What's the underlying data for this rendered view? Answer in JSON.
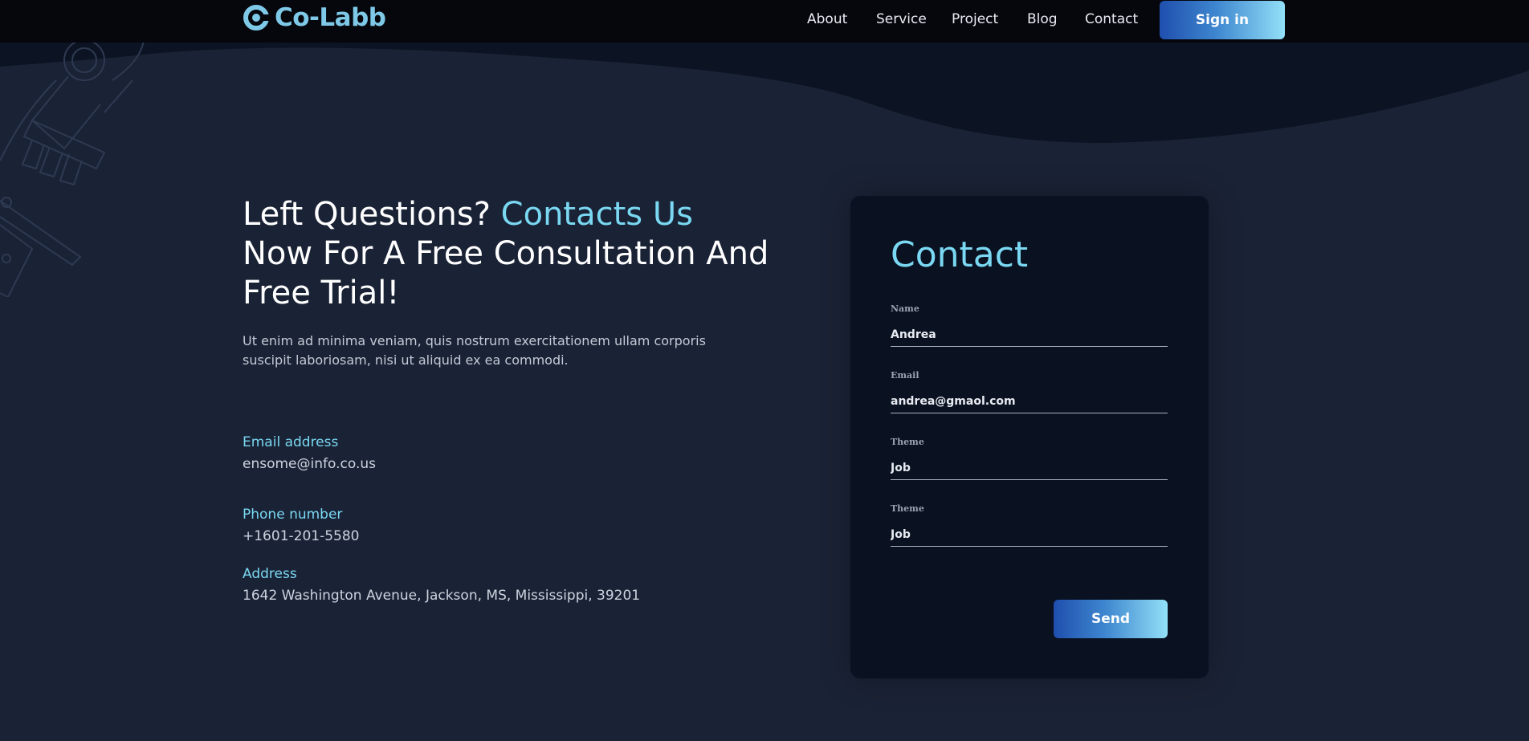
{
  "brand": {
    "name": "Co-Labb",
    "color": "#7fc9e8"
  },
  "nav": {
    "items": [
      {
        "label": "About"
      },
      {
        "label": "Service"
      },
      {
        "label": "Project"
      },
      {
        "label": "Blog"
      },
      {
        "label": "Contact"
      }
    ],
    "signin_label": "Sign in"
  },
  "hero": {
    "headline_prefix": "Left Questions? ",
    "headline_accent": "Contacts Us",
    "headline_suffix": " Now For A Free Consultation And Free Trial!",
    "intro": "Ut enim ad minima veniam, quis nostrum exercitationem ullam corporis suscipit laboriosam, nisi ut aliquid ex ea commodi."
  },
  "contact_info": {
    "email_label": "Email address",
    "email_value": "ensome@info.co.us",
    "phone_label": "Phone number",
    "phone_value": "+1601-201-5580",
    "address_label": "Address",
    "address_value": "1642 Washington Avenue, Jackson, MS, Mississippi, 39201"
  },
  "form": {
    "title": "Contact",
    "fields": [
      {
        "label": "Name",
        "value": "Andrea"
      },
      {
        "label": "Email",
        "value": "andrea@gmaol.com"
      },
      {
        "label": "Theme",
        "value": "Job"
      },
      {
        "label": "Theme",
        "value": "Job"
      }
    ],
    "send_label": "Send"
  },
  "colors": {
    "background": "#1a2235",
    "topbar": "#05070d",
    "card": "#0a1120",
    "accent": "#7ad8f2",
    "button_gradient_start": "#1f4fae",
    "button_gradient_end": "#92e0f8"
  },
  "icons": {
    "logo_mark": "c-logo-icon",
    "decoration": "microscope-outline-icon"
  }
}
